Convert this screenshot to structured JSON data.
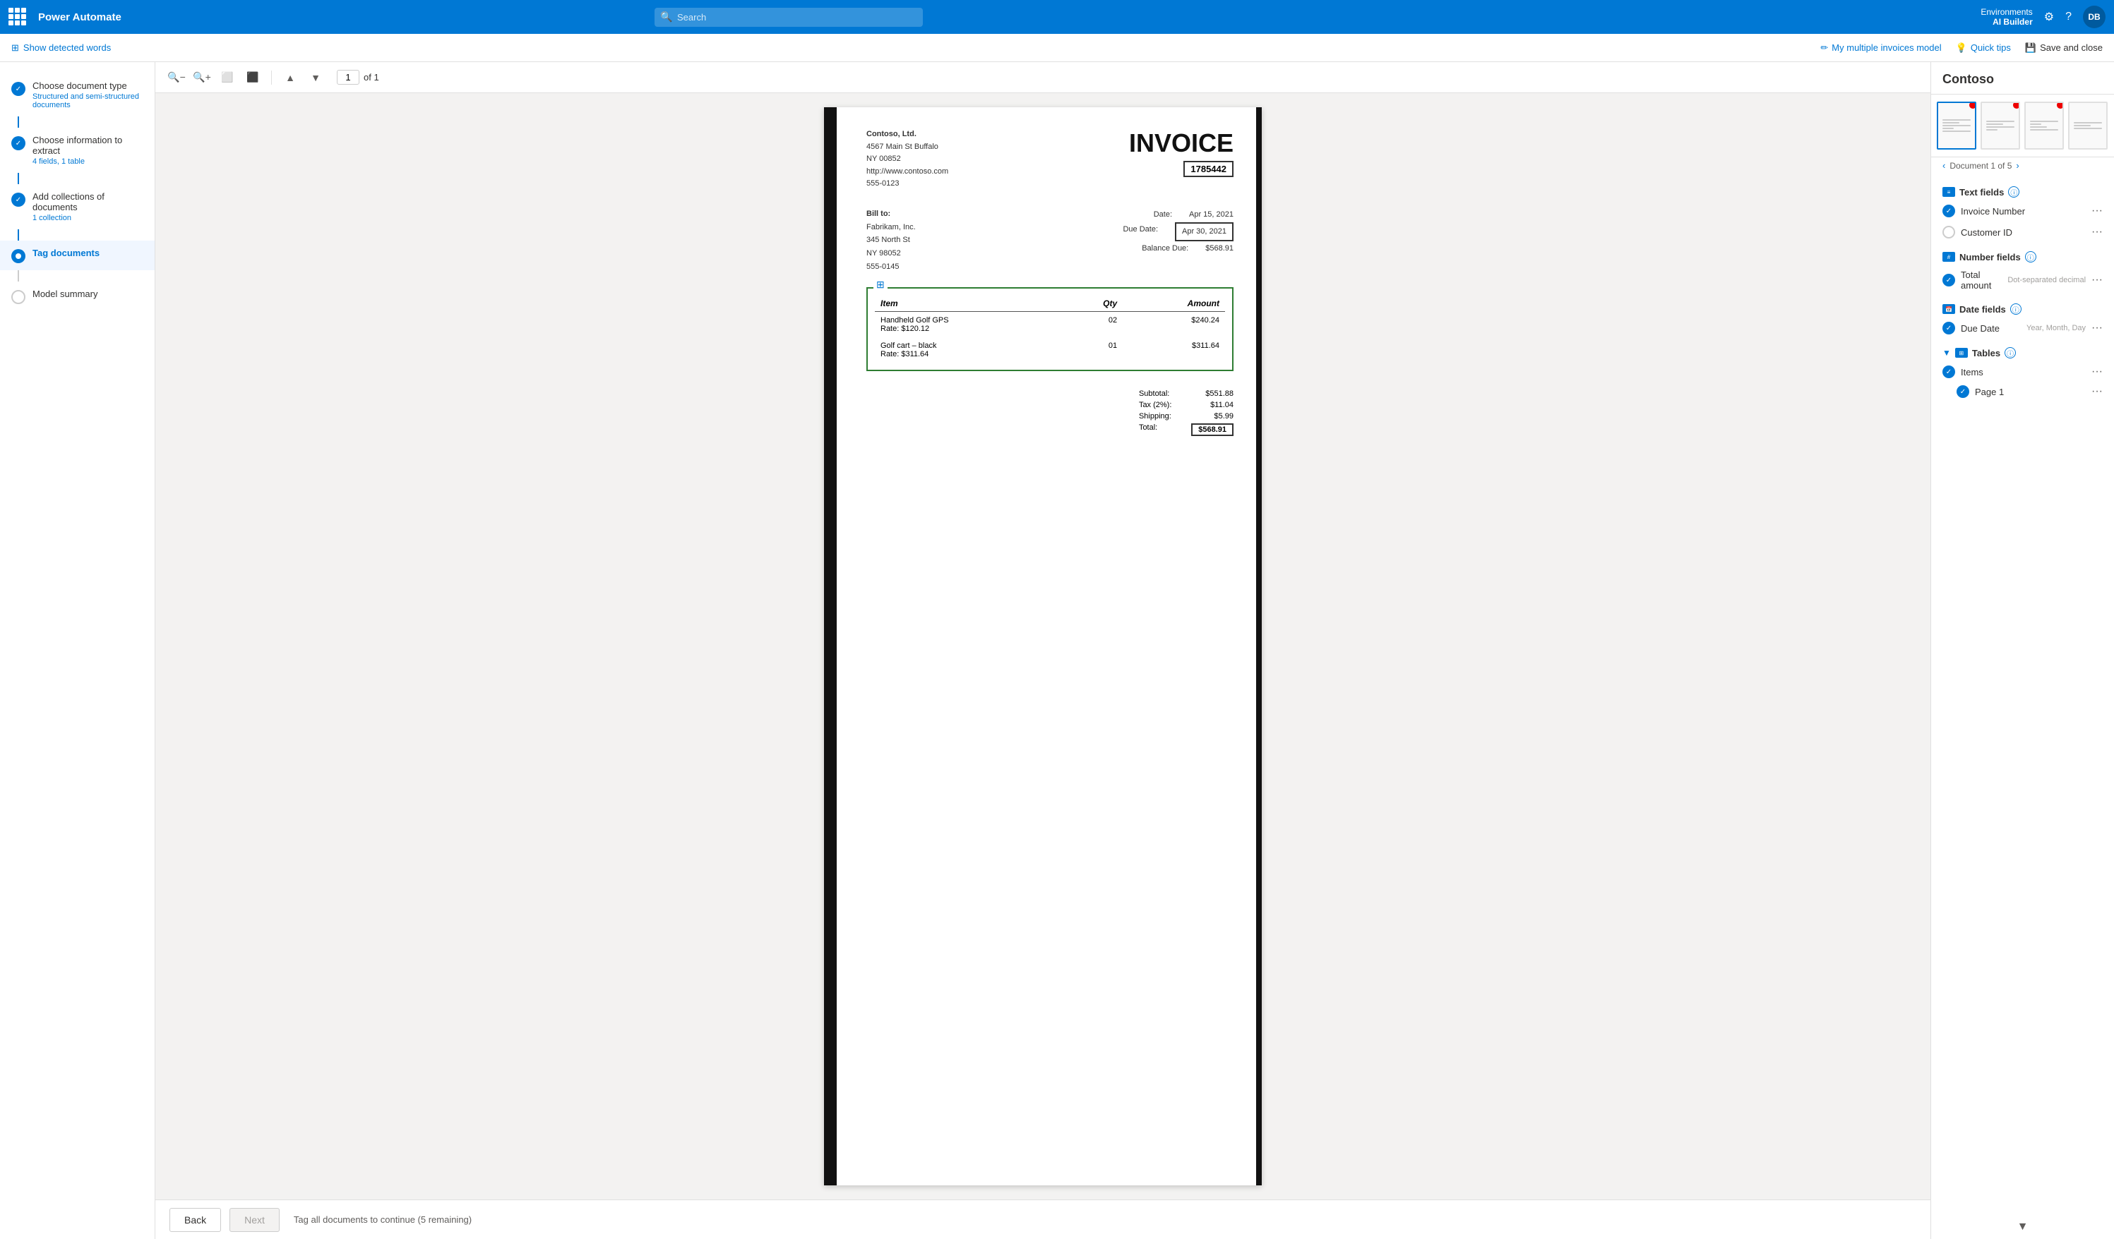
{
  "topnav": {
    "app_title": "Power Automate",
    "search_placeholder": "Search",
    "env_label": "Environments",
    "env_name": "AI Builder",
    "avatar_initials": "DB"
  },
  "subheader": {
    "show_words": "Show detected words",
    "model_link": "My multiple invoices model",
    "quick_tips": "Quick tips",
    "save_close": "Save and close"
  },
  "toolbar": {
    "page_input": "1",
    "page_total": "of 1"
  },
  "sidebar": {
    "items": [
      {
        "title": "Choose document type",
        "sub": "Structured and semi-structured documents",
        "state": "done",
        "icon": "✓"
      },
      {
        "title": "Choose information to extract",
        "sub": "4 fields, 1 table",
        "state": "done",
        "icon": "✓"
      },
      {
        "title": "Add collections of documents",
        "sub": "1 collection",
        "state": "done",
        "icon": "✓"
      },
      {
        "title": "Tag documents",
        "sub": "",
        "state": "active",
        "icon": "●"
      },
      {
        "title": "Model summary",
        "sub": "",
        "state": "pending",
        "icon": ""
      }
    ]
  },
  "invoice": {
    "company_name": "Contoso, Ltd.",
    "company_address": "4567 Main St Buffalo",
    "company_city": "NY 00852",
    "company_web": "http://www.contoso.com",
    "company_phone": "555-0123",
    "title": "INVOICE",
    "number": "1785442",
    "bill_to_label": "Bill to:",
    "customer_name": "Fabrikam, Inc.",
    "customer_address": "345 North St",
    "customer_city": "NY 98052",
    "customer_phone": "555-0145",
    "date_label": "Date:",
    "date_value": "Apr 15, 2021",
    "due_date_label": "Due Date:",
    "due_date_value": "Apr 30, 2021",
    "balance_due_label": "Balance Due:",
    "balance_due_value": "$568.91",
    "table_headers": [
      "Item",
      "Qty",
      "Amount"
    ],
    "table_rows": [
      {
        "item": "Handheld Golf GPS\nRate: $120.12",
        "qty": "02",
        "amount": "$240.24"
      },
      {
        "item": "Golf cart – black\nRate: $311.64",
        "qty": "01",
        "amount": "$311.64"
      }
    ],
    "subtotal_label": "Subtotal:",
    "subtotal_value": "$551.88",
    "tax_label": "Tax (2%):",
    "tax_value": "$11.04",
    "shipping_label": "Shipping:",
    "shipping_value": "$5.99",
    "total_label": "Total:",
    "total_value": "$568.91"
  },
  "right_panel": {
    "title": "Contoso",
    "doc_counter": "Document 1 of 5",
    "text_fields_label": "Text fields",
    "number_fields_label": "Number fields",
    "date_fields_label": "Date fields",
    "tables_label": "Tables",
    "fields": {
      "invoice_number": "Invoice Number",
      "customer_id": "Customer ID",
      "total_amount": "Total amount",
      "total_amount_hint": "Dot-separated decimal",
      "due_date": "Due Date",
      "due_date_hint": "Year, Month, Day",
      "items": "Items",
      "page1": "Page 1"
    }
  },
  "footer": {
    "back_label": "Back",
    "next_label": "Next",
    "status": "Tag all documents to continue (5 remaining)"
  }
}
